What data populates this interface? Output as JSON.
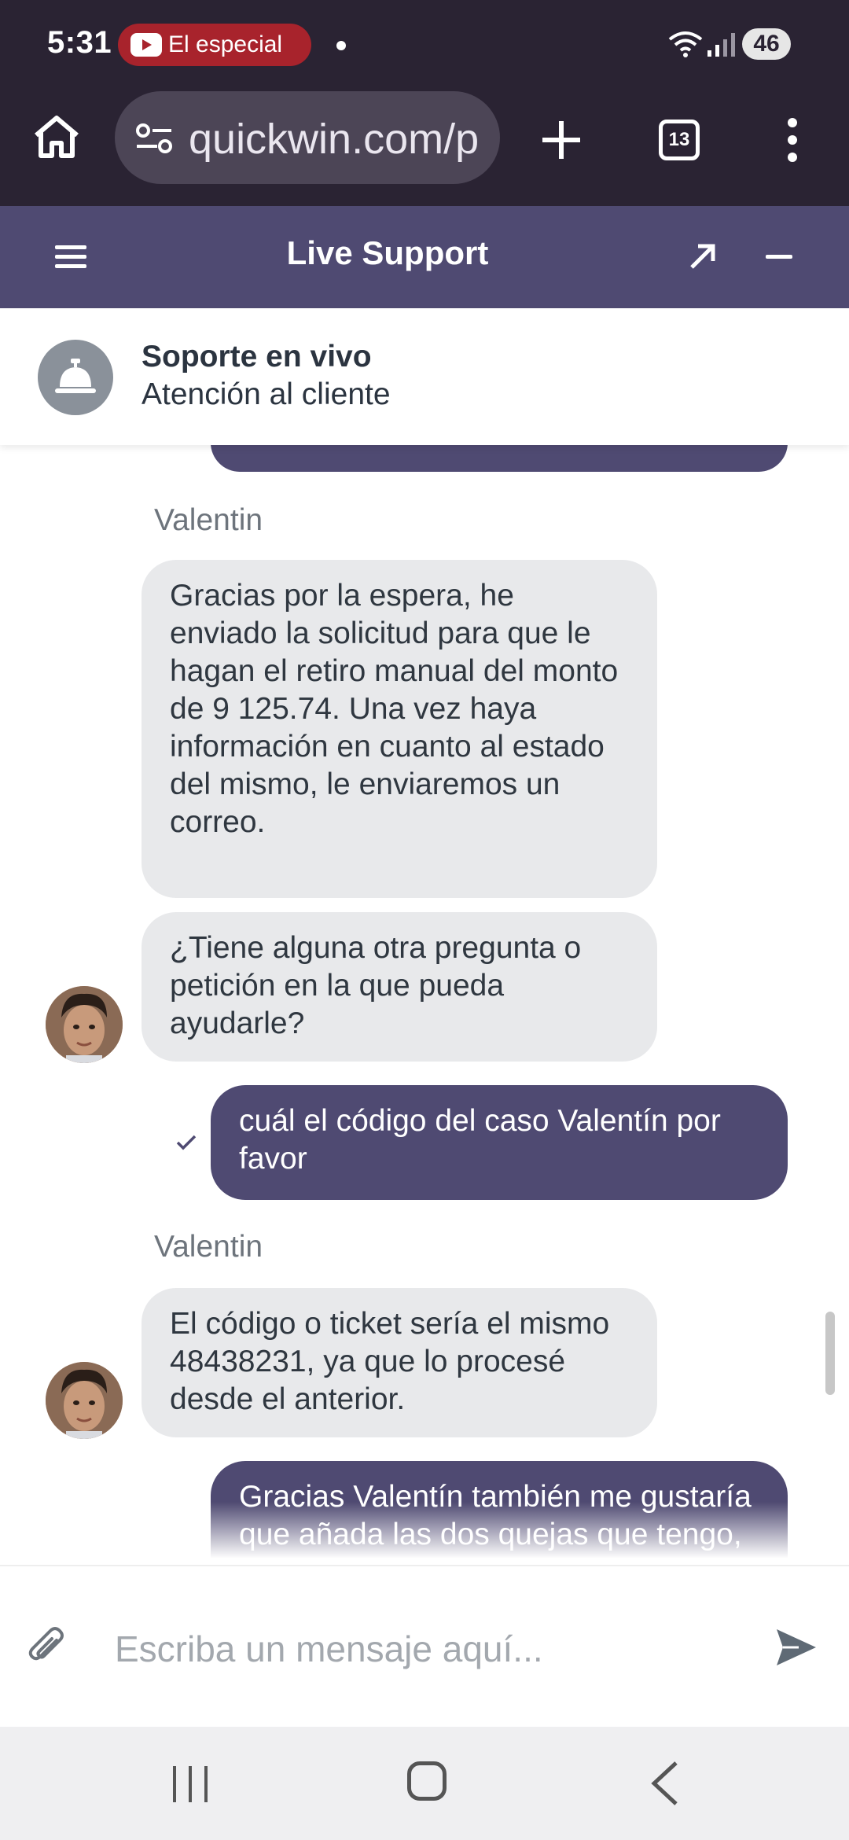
{
  "status_bar": {
    "time": "5:31",
    "media_pill": "El especial",
    "battery": "46"
  },
  "browser": {
    "url": "quickwin.com/p",
    "tab_count": "13"
  },
  "widget": {
    "title": "Live Support"
  },
  "agent": {
    "name": "Soporte en vivo",
    "subtitle": "Atención al cliente"
  },
  "messages": [
    {
      "from": "user",
      "text": ""
    },
    {
      "from": "agent",
      "sender": "Valentin",
      "text": "Gracias por la espera, he enviado la solicitud para que le hagan el retiro manual del monto de 9 125.74. Una vez haya información en cuanto al estado del mismo, le enviaremos un correo."
    },
    {
      "from": "agent",
      "text": "¿Tiene alguna otra pregunta o petición en la que pueda ayudarle?"
    },
    {
      "from": "user",
      "text": "cuál  el código del caso Valentín por favor",
      "status": "read"
    },
    {
      "from": "agent",
      "sender": "Valentin",
      "text": "El código o ticket sería el mismo 48438231, ya que lo procesé desde el anterior."
    },
    {
      "from": "user",
      "text": "Gracias Valentín también me gustaría que añada las dos quejas que tengo, por las cuales no he podido retirar"
    }
  ],
  "composer": {
    "placeholder": "Escriba un mensaje aquí..."
  },
  "colors": {
    "header": "#4f4a72",
    "user_bubble": "#4f4a72",
    "agent_bubble": "#e8e9eb",
    "browser_chrome": "#2a2333"
  }
}
